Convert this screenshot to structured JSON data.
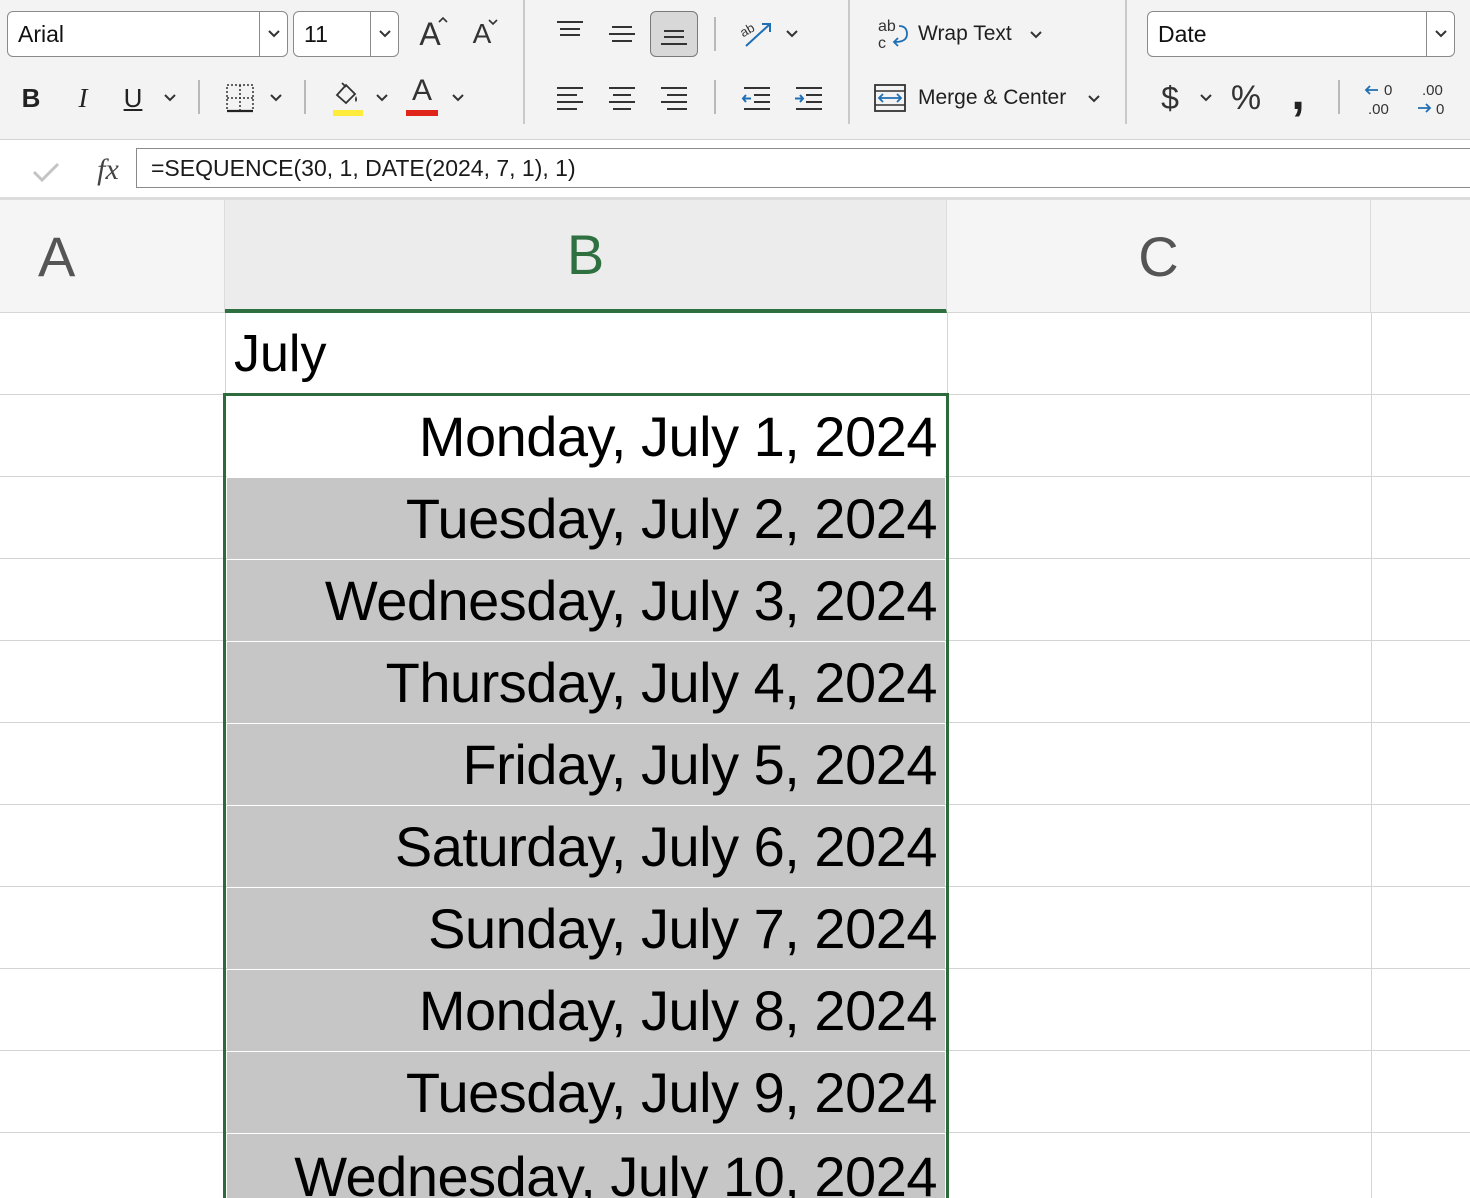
{
  "ribbon": {
    "font_name": "Arial",
    "font_size": "11",
    "wrap_text_label": "Wrap Text",
    "merge_center_label": "Merge & Center",
    "number_format": "Date",
    "bold": "B",
    "italic": "I",
    "underline": "U",
    "currency": "$",
    "percent": "%",
    "comma": ",",
    "grow_font": "A",
    "shrink_font": "A",
    "font_color_glyph": "A",
    "highlight_color": "#ffeb3b",
    "font_color": "#e0251b",
    "wrap_ab": "ab",
    "wrap_c": "c",
    "dec_inc_top": "0",
    "dec_inc_bottom": ".00",
    "dec_dec_top": ".00",
    "dec_dec_bottom": "0"
  },
  "formula_bar": {
    "fx": "fx",
    "formula": "=SEQUENCE(30, 1, DATE(2024, 7, 1), 1)"
  },
  "columns": [
    "A",
    "B",
    "C"
  ],
  "header_cell": "July",
  "cells": [
    "Monday, July 1, 2024",
    "Tuesday, July 2, 2024",
    "Wednesday, July 3, 2024",
    "Thursday, July 4, 2024",
    "Friday, July 5, 2024",
    "Saturday, July 6, 2024",
    "Sunday, July 7, 2024",
    "Monday, July 8, 2024",
    "Tuesday, July 9, 2024",
    "Wednesday, July 10, 2024"
  ],
  "colors": {
    "accent_green": "#2e6b3c",
    "selection_fill": "#c6c6c6"
  }
}
